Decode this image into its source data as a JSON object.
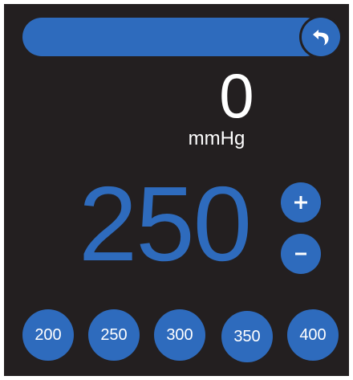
{
  "pressure": {
    "current_value": "0",
    "unit": "mmHg",
    "target_value": "250",
    "progress_fraction": 1.0
  },
  "presets": [
    "200",
    "250",
    "300",
    "350",
    "400"
  ],
  "colors": {
    "background": "#231f20",
    "accent": "#2e6bbd",
    "text": "#ffffff"
  },
  "icons": {
    "back": "undo-arrow-icon",
    "increase": "plus-icon",
    "decrease": "minus-icon"
  }
}
